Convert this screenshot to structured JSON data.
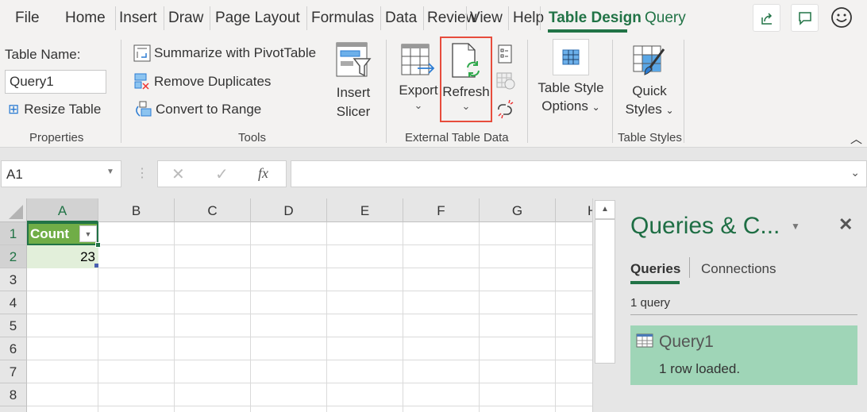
{
  "tabs": [
    "File",
    "Home",
    "Insert",
    "Draw",
    "Page Layout",
    "Formulas",
    "Data",
    "Review",
    "View",
    "Help",
    "Table Design",
    "Query"
  ],
  "properties": {
    "label": "Table Name:",
    "table_name": "Query1",
    "resize": "Resize Table",
    "group": "Properties"
  },
  "tools": {
    "summarize": "Summarize with PivotTable",
    "remove_dup": "Remove Duplicates",
    "convert": "Convert to Range",
    "slicer_1": "Insert",
    "slicer_2": "Slicer",
    "group": "Tools"
  },
  "external": {
    "export": "Export",
    "refresh": "Refresh",
    "group": "External Table Data"
  },
  "styles": {
    "options_1": "Table Style",
    "options_2": "Options",
    "quick_1": "Quick",
    "quick_2": "Styles",
    "group": "Table Styles"
  },
  "formula_bar": {
    "name_box": "A1",
    "fx": "fx",
    "formula": ""
  },
  "columns": [
    "A",
    "B",
    "C",
    "D",
    "E",
    "F",
    "G",
    "H"
  ],
  "rows": [
    "1",
    "2",
    "3",
    "4",
    "5",
    "6",
    "7",
    "8"
  ],
  "cells": {
    "A1": "Count",
    "A2": "23"
  },
  "pane": {
    "title": "Queries & C...",
    "tab_queries": "Queries",
    "tab_connections": "Connections",
    "count": "1 query",
    "query_name": "Query1",
    "query_status": "1 row loaded."
  },
  "colors": {
    "accent": "#217346",
    "header_fill": "#70ad47",
    "query_bg": "#9fd5b7",
    "highlight": "#e74c3c"
  }
}
